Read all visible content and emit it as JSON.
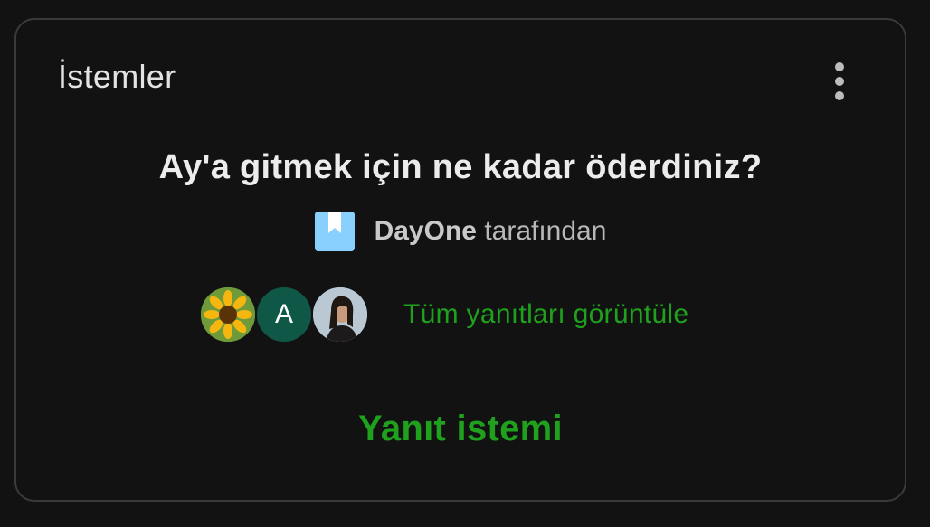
{
  "card": {
    "title": "İstemler",
    "menu_icon": "more-vertical-icon"
  },
  "prompt": {
    "question": "Ay'a gitmek için ne kadar öderdiniz?",
    "source_icon": "bookmark-icon",
    "author": "DayOne",
    "author_suffix": "tarafından"
  },
  "responses": {
    "avatars": [
      {
        "type": "image",
        "description_icon": "sunflower-avatar"
      },
      {
        "type": "letter",
        "letter": "A"
      },
      {
        "type": "image",
        "description_icon": "person-photo-avatar"
      }
    ],
    "view_all_label": "Tüm yanıtları görüntüle"
  },
  "action": {
    "answer_label": "Yanıt istemi"
  },
  "colors": {
    "background": "#121212",
    "accent_green": "#1fa11d",
    "bookmark_blue": "#8ad0ff",
    "avatar_letter_bg": "#0f5746"
  }
}
